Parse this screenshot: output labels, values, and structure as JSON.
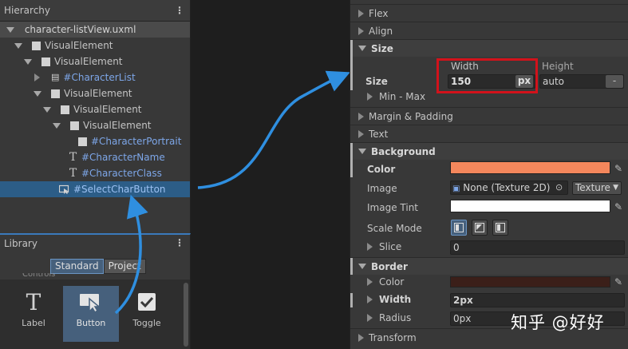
{
  "hierarchy": {
    "title": "Hierarchy",
    "file": "character-listView.uxml",
    "nodes": [
      {
        "label": "VisualElement"
      },
      {
        "label": "VisualElement"
      },
      {
        "label": "#CharacterList"
      },
      {
        "label": "VisualElement"
      },
      {
        "label": "VisualElement"
      },
      {
        "label": "VisualElement"
      },
      {
        "label": "#CharacterPortrait"
      },
      {
        "label": "#CharacterName"
      },
      {
        "label": "#CharacterClass"
      },
      {
        "label": "#SelectCharButton"
      }
    ]
  },
  "library": {
    "title": "Library",
    "tabs": [
      "Standard",
      "Project"
    ],
    "category": "Controls",
    "items": [
      {
        "label": "Label",
        "icon": "text-t-icon"
      },
      {
        "label": "Button",
        "icon": "button-cursor-icon"
      },
      {
        "label": "Toggle",
        "icon": "checkbox-icon"
      }
    ]
  },
  "inspector": {
    "sections": {
      "flex": "Flex",
      "align": "Align",
      "size": "Size",
      "margin": "Margin & Padding",
      "text": "Text",
      "background": "Background",
      "border": "Border",
      "transform": "Transform"
    },
    "size": {
      "label": "Size",
      "width_header": "Width",
      "height_header": "Height",
      "width_value": "150",
      "width_unit": "px",
      "height_value": "auto",
      "height_unit": "-",
      "minmax": "Min - Max"
    },
    "background": {
      "color_label": "Color",
      "color": "#f4875c",
      "image_label": "Image",
      "image_value": "None (Texture 2D)",
      "image_type": "Texture",
      "tint_label": "Image Tint",
      "tint_color": "#ffffff",
      "scale_label": "Scale Mode",
      "slice_label": "Slice",
      "slice_value": "0"
    },
    "border": {
      "color_label": "Color",
      "color": "#3b1f19",
      "width_label": "Width",
      "width_value": "2px",
      "radius_label": "Radius",
      "radius_value": "0px"
    }
  },
  "watermark": "知乎 @好好",
  "colors": {
    "arrow": "#2f8fe0",
    "highlight": "#d2121b",
    "selection": "#2c5d87"
  }
}
